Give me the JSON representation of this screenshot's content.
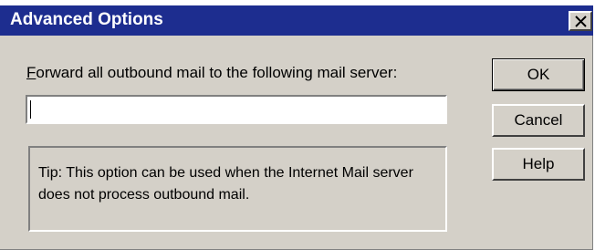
{
  "window": {
    "title": "Advanced Options",
    "close_glyph": "×"
  },
  "form": {
    "label_accel": "F",
    "label_rest": "orward all outbound mail to the following mail server:",
    "server_value": ""
  },
  "tip": {
    "text": "Tip: This option can be used when the Internet Mail server does not process outbound mail."
  },
  "buttons": {
    "ok": "OK",
    "cancel": "Cancel",
    "help": "Help"
  },
  "colors": {
    "titlebar": "#1d2d8f",
    "face": "#d4d0c8"
  }
}
